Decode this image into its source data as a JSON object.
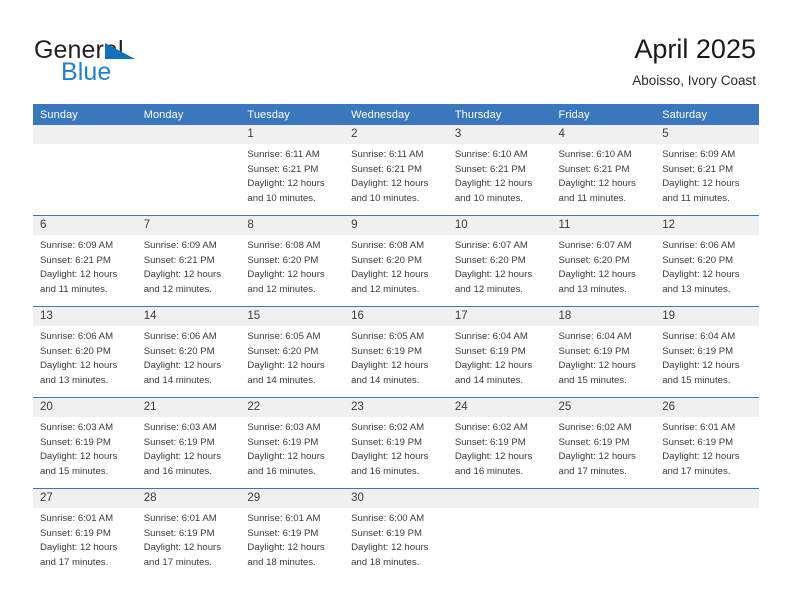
{
  "logo": {
    "primary_text": "General",
    "secondary_text": "Blue",
    "triangle_color": "#0f6fc0",
    "primary_color": "#231f20",
    "secondary_color": "#1f7fd0"
  },
  "header": {
    "title": "April 2025",
    "subtitle": "Aboisso, Ivory Coast"
  },
  "theme": {
    "header_blue": "#3a77bc",
    "daynum_band": "#f0f0f0",
    "text": "#3b3b3b"
  },
  "calendar": {
    "weekday_headers": [
      "Sunday",
      "Monday",
      "Tuesday",
      "Wednesday",
      "Thursday",
      "Friday",
      "Saturday"
    ],
    "weeks": [
      [
        {
          "day": "",
          "lines": []
        },
        {
          "day": "",
          "lines": []
        },
        {
          "day": "1",
          "lines": [
            "Sunrise: 6:11 AM",
            "Sunset: 6:21 PM",
            "Daylight: 12 hours",
            "and 10 minutes."
          ]
        },
        {
          "day": "2",
          "lines": [
            "Sunrise: 6:11 AM",
            "Sunset: 6:21 PM",
            "Daylight: 12 hours",
            "and 10 minutes."
          ]
        },
        {
          "day": "3",
          "lines": [
            "Sunrise: 6:10 AM",
            "Sunset: 6:21 PM",
            "Daylight: 12 hours",
            "and 10 minutes."
          ]
        },
        {
          "day": "4",
          "lines": [
            "Sunrise: 6:10 AM",
            "Sunset: 6:21 PM",
            "Daylight: 12 hours",
            "and 11 minutes."
          ]
        },
        {
          "day": "5",
          "lines": [
            "Sunrise: 6:09 AM",
            "Sunset: 6:21 PM",
            "Daylight: 12 hours",
            "and 11 minutes."
          ]
        }
      ],
      [
        {
          "day": "6",
          "lines": [
            "Sunrise: 6:09 AM",
            "Sunset: 6:21 PM",
            "Daylight: 12 hours",
            "and 11 minutes."
          ]
        },
        {
          "day": "7",
          "lines": [
            "Sunrise: 6:09 AM",
            "Sunset: 6:21 PM",
            "Daylight: 12 hours",
            "and 12 minutes."
          ]
        },
        {
          "day": "8",
          "lines": [
            "Sunrise: 6:08 AM",
            "Sunset: 6:20 PM",
            "Daylight: 12 hours",
            "and 12 minutes."
          ]
        },
        {
          "day": "9",
          "lines": [
            "Sunrise: 6:08 AM",
            "Sunset: 6:20 PM",
            "Daylight: 12 hours",
            "and 12 minutes."
          ]
        },
        {
          "day": "10",
          "lines": [
            "Sunrise: 6:07 AM",
            "Sunset: 6:20 PM",
            "Daylight: 12 hours",
            "and 12 minutes."
          ]
        },
        {
          "day": "11",
          "lines": [
            "Sunrise: 6:07 AM",
            "Sunset: 6:20 PM",
            "Daylight: 12 hours",
            "and 13 minutes."
          ]
        },
        {
          "day": "12",
          "lines": [
            "Sunrise: 6:06 AM",
            "Sunset: 6:20 PM",
            "Daylight: 12 hours",
            "and 13 minutes."
          ]
        }
      ],
      [
        {
          "day": "13",
          "lines": [
            "Sunrise: 6:06 AM",
            "Sunset: 6:20 PM",
            "Daylight: 12 hours",
            "and 13 minutes."
          ]
        },
        {
          "day": "14",
          "lines": [
            "Sunrise: 6:06 AM",
            "Sunset: 6:20 PM",
            "Daylight: 12 hours",
            "and 14 minutes."
          ]
        },
        {
          "day": "15",
          "lines": [
            "Sunrise: 6:05 AM",
            "Sunset: 6:20 PM",
            "Daylight: 12 hours",
            "and 14 minutes."
          ]
        },
        {
          "day": "16",
          "lines": [
            "Sunrise: 6:05 AM",
            "Sunset: 6:19 PM",
            "Daylight: 12 hours",
            "and 14 minutes."
          ]
        },
        {
          "day": "17",
          "lines": [
            "Sunrise: 6:04 AM",
            "Sunset: 6:19 PM",
            "Daylight: 12 hours",
            "and 14 minutes."
          ]
        },
        {
          "day": "18",
          "lines": [
            "Sunrise: 6:04 AM",
            "Sunset: 6:19 PM",
            "Daylight: 12 hours",
            "and 15 minutes."
          ]
        },
        {
          "day": "19",
          "lines": [
            "Sunrise: 6:04 AM",
            "Sunset: 6:19 PM",
            "Daylight: 12 hours",
            "and 15 minutes."
          ]
        }
      ],
      [
        {
          "day": "20",
          "lines": [
            "Sunrise: 6:03 AM",
            "Sunset: 6:19 PM",
            "Daylight: 12 hours",
            "and 15 minutes."
          ]
        },
        {
          "day": "21",
          "lines": [
            "Sunrise: 6:03 AM",
            "Sunset: 6:19 PM",
            "Daylight: 12 hours",
            "and 16 minutes."
          ]
        },
        {
          "day": "22",
          "lines": [
            "Sunrise: 6:03 AM",
            "Sunset: 6:19 PM",
            "Daylight: 12 hours",
            "and 16 minutes."
          ]
        },
        {
          "day": "23",
          "lines": [
            "Sunrise: 6:02 AM",
            "Sunset: 6:19 PM",
            "Daylight: 12 hours",
            "and 16 minutes."
          ]
        },
        {
          "day": "24",
          "lines": [
            "Sunrise: 6:02 AM",
            "Sunset: 6:19 PM",
            "Daylight: 12 hours",
            "and 16 minutes."
          ]
        },
        {
          "day": "25",
          "lines": [
            "Sunrise: 6:02 AM",
            "Sunset: 6:19 PM",
            "Daylight: 12 hours",
            "and 17 minutes."
          ]
        },
        {
          "day": "26",
          "lines": [
            "Sunrise: 6:01 AM",
            "Sunset: 6:19 PM",
            "Daylight: 12 hours",
            "and 17 minutes."
          ]
        }
      ],
      [
        {
          "day": "27",
          "lines": [
            "Sunrise: 6:01 AM",
            "Sunset: 6:19 PM",
            "Daylight: 12 hours",
            "and 17 minutes."
          ]
        },
        {
          "day": "28",
          "lines": [
            "Sunrise: 6:01 AM",
            "Sunset: 6:19 PM",
            "Daylight: 12 hours",
            "and 17 minutes."
          ]
        },
        {
          "day": "29",
          "lines": [
            "Sunrise: 6:01 AM",
            "Sunset: 6:19 PM",
            "Daylight: 12 hours",
            "and 18 minutes."
          ]
        },
        {
          "day": "30",
          "lines": [
            "Sunrise: 6:00 AM",
            "Sunset: 6:19 PM",
            "Daylight: 12 hours",
            "and 18 minutes."
          ]
        },
        {
          "day": "",
          "lines": []
        },
        {
          "day": "",
          "lines": []
        },
        {
          "day": "",
          "lines": []
        }
      ]
    ]
  }
}
